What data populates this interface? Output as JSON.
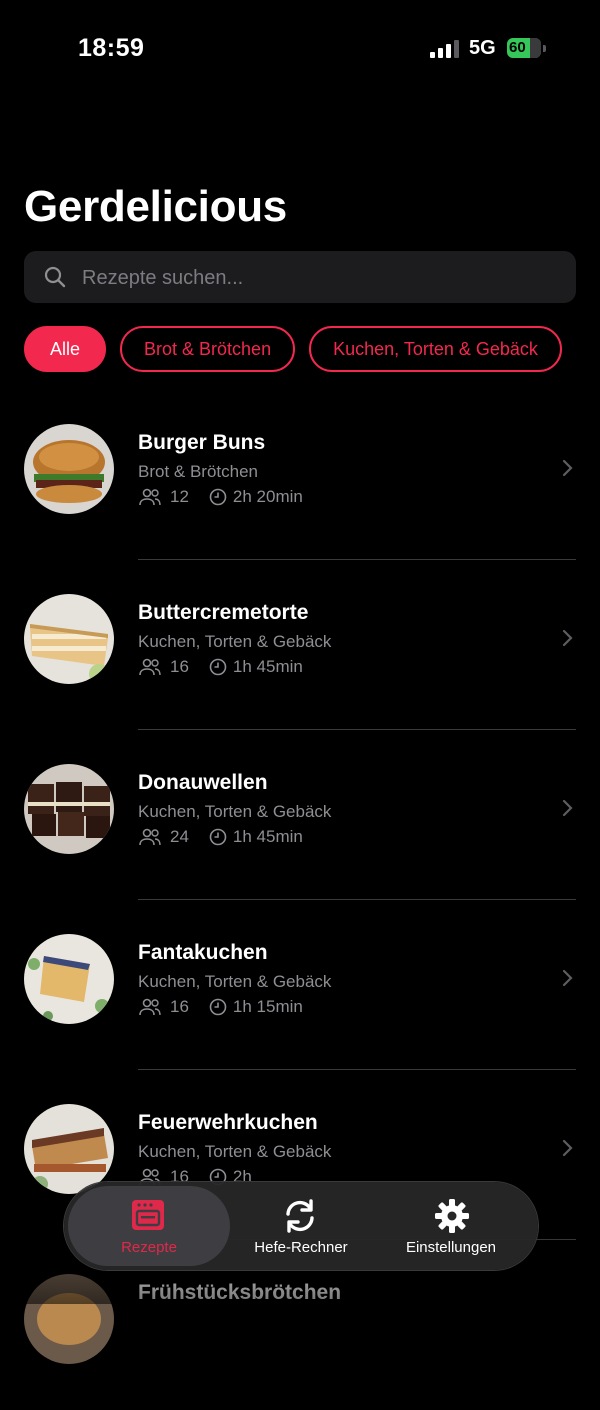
{
  "status_bar": {
    "time": "18:59",
    "network": "5G",
    "battery": "60"
  },
  "header": {
    "title": "Gerdelicious"
  },
  "search": {
    "placeholder": "Rezepte suchen..."
  },
  "filters": [
    {
      "label": "Alle",
      "active": true
    },
    {
      "label": "Brot & Brötchen",
      "active": false
    },
    {
      "label": "Kuchen, Torten & Gebäck",
      "active": false
    }
  ],
  "recipes": [
    {
      "name": "Burger Buns",
      "category": "Brot & Brötchen",
      "servings": "12",
      "duration": "2h 20min"
    },
    {
      "name": "Buttercremetorte",
      "category": "Kuchen, Torten & Gebäck",
      "servings": "16",
      "duration": "1h 45min"
    },
    {
      "name": "Donauwellen",
      "category": "Kuchen, Torten & Gebäck",
      "servings": "24",
      "duration": "1h 45min"
    },
    {
      "name": "Fantakuchen",
      "category": "Kuchen, Torten & Gebäck",
      "servings": "16",
      "duration": "1h 15min"
    },
    {
      "name": "Feuerwehrkuchen",
      "category": "Kuchen, Torten & Gebäck",
      "servings": "16",
      "duration": "2h"
    },
    {
      "name": "Frühstücksbrötchen",
      "category": "",
      "servings": "",
      "duration": ""
    }
  ],
  "tabbar": {
    "tabs": [
      {
        "label": "Rezepte",
        "icon": "oven-icon",
        "active": true
      },
      {
        "label": "Hefe-Rechner",
        "icon": "refresh-icon",
        "active": false
      },
      {
        "label": "Einstellungen",
        "icon": "gear-icon",
        "active": false
      }
    ],
    "accent": "#e0284a"
  },
  "colors": {
    "accent": "#f2284e",
    "background": "#000000",
    "secondary_text": "#8e8e93"
  }
}
